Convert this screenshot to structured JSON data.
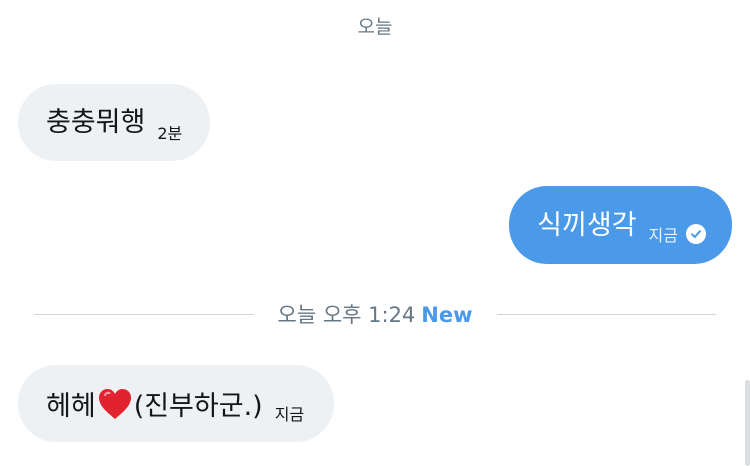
{
  "date_header": "오늘",
  "messages": [
    {
      "text": "충충뭐행",
      "time": "2분",
      "direction": "incoming"
    },
    {
      "text": "식끼생각",
      "time": "지금",
      "direction": "outgoing",
      "status_icon": "read-check-icon"
    },
    {
      "text_before": "헤헤",
      "emoji": "heart-icon",
      "text_after": "(진부하군.)",
      "time": "지금",
      "direction": "incoming"
    }
  ],
  "divider": {
    "label": "오늘 오후 1:24",
    "badge": "New"
  },
  "colors": {
    "outgoing_bubble": "#4b99e9",
    "incoming_bubble": "#eef1f3",
    "accent": "#4b99e9",
    "muted_text": "#657786",
    "heart": "#e0232e"
  }
}
